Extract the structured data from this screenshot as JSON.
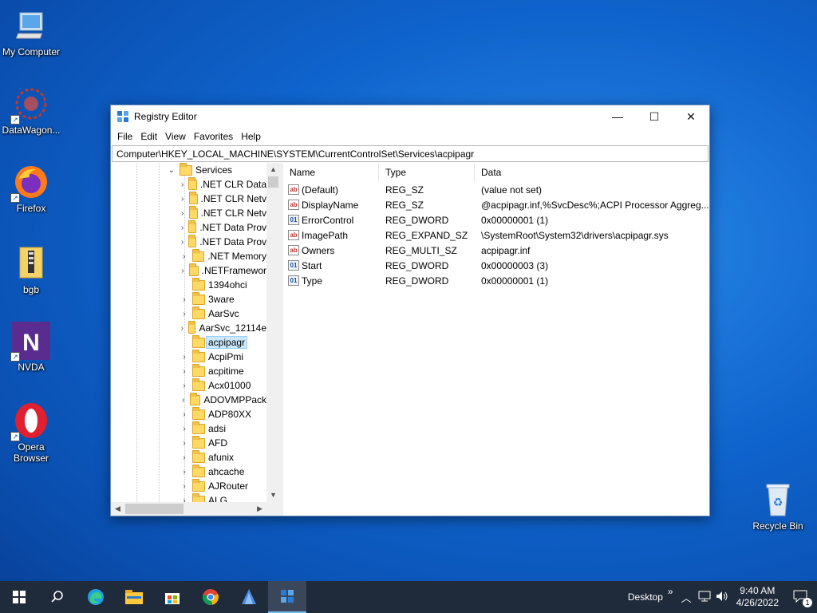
{
  "desktop": {
    "icons": [
      {
        "label": "My Computer",
        "icon": "computer-icon"
      },
      {
        "label": "DataWagon...",
        "icon": "datawagon-icon"
      },
      {
        "label": "Firefox",
        "icon": "firefox-icon"
      },
      {
        "label": "bgb",
        "icon": "zip-folder-icon"
      },
      {
        "label": "NVDA",
        "icon": "nvda-icon"
      },
      {
        "label": "Opera Browser",
        "icon": "opera-icon"
      },
      {
        "label": "Recycle Bin",
        "icon": "recycle-bin-icon"
      }
    ]
  },
  "window": {
    "title": "Registry Editor",
    "controls": {
      "minimize": "—",
      "maximize": "☐",
      "close": "✕"
    },
    "menu": [
      "File",
      "Edit",
      "View",
      "Favorites",
      "Help"
    ],
    "address": "Computer\\HKEY_LOCAL_MACHINE\\SYSTEM\\CurrentControlSet\\Services\\acpipagr",
    "tree": {
      "parent": "Services",
      "items": [
        ".NET CLR Data",
        ".NET CLR Netv",
        ".NET CLR Netv",
        ".NET Data Prov",
        ".NET Data Prov",
        ".NET Memory",
        ".NETFramewor",
        "1394ohci",
        "3ware",
        "AarSvc",
        "AarSvc_12114e",
        "acpipagr",
        "AcpiPmi",
        "acpitime",
        "Acx01000",
        "ADOVMPPack",
        "ADP80XX",
        "adsi",
        "AFD",
        "afunix",
        "ahcache",
        "AJRouter",
        "ALG"
      ],
      "selected": "acpipagr"
    },
    "values": {
      "headers": [
        "Name",
        "Type",
        "Data"
      ],
      "rows": [
        {
          "name": "(Default)",
          "type": "REG_SZ",
          "data": "(value not set)",
          "icon": "ab"
        },
        {
          "name": "DisplayName",
          "type": "REG_SZ",
          "data": "@acpipagr.inf,%SvcDesc%;ACPI Processor Aggreg...",
          "icon": "ab"
        },
        {
          "name": "ErrorControl",
          "type": "REG_DWORD",
          "data": "0x00000001 (1)",
          "icon": "bin"
        },
        {
          "name": "ImagePath",
          "type": "REG_EXPAND_SZ",
          "data": "\\SystemRoot\\System32\\drivers\\acpipagr.sys",
          "icon": "ab"
        },
        {
          "name": "Owners",
          "type": "REG_MULTI_SZ",
          "data": "acpipagr.inf",
          "icon": "ab"
        },
        {
          "name": "Start",
          "type": "REG_DWORD",
          "data": "0x00000003 (3)",
          "icon": "bin"
        },
        {
          "name": "Type",
          "type": "REG_DWORD",
          "data": "0x00000001 (1)",
          "icon": "bin"
        }
      ]
    }
  },
  "taskbar": {
    "desktop_label": "Desktop",
    "overflow": "»",
    "time": "9:40 AM",
    "date": "4/26/2022",
    "notification_count": "1"
  }
}
